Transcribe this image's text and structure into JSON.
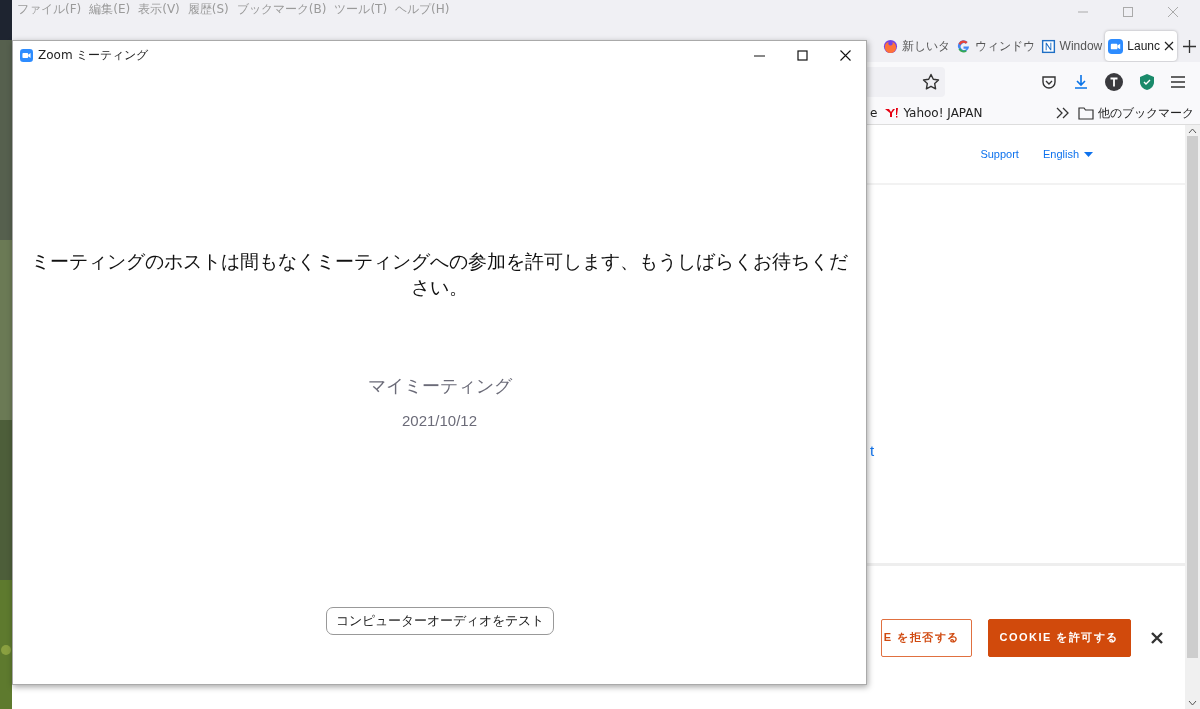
{
  "browser": {
    "menu_bar": [
      "ファイル(F)",
      "編集(E)",
      "表示(V)",
      "履歴(S)",
      "ブックマーク(B)",
      "ツール(T)",
      "ヘルプ(H)"
    ],
    "tabs": [
      {
        "label": "新しいタ",
        "kind": "fox",
        "selected": false
      },
      {
        "label": "ウィンドウ",
        "kind": "g",
        "selected": false
      },
      {
        "label": "Window",
        "kind": "n",
        "selected": false
      },
      {
        "label": "Launc",
        "kind": "camera",
        "selected": true
      }
    ],
    "bookmarks": [
      "e",
      "Yahoo! JAPAN"
    ],
    "other_bookmarks": "他のブックマーク",
    "page": {
      "nav": [
        "Support",
        "English"
      ],
      "link_fragment": "t",
      "cookie_buttons": [
        {
          "label": "E を拒否する",
          "kind": "outline"
        },
        {
          "label": "COOKIE を許可する",
          "kind": "filled"
        }
      ]
    }
  },
  "zoom_window": {
    "title": "Zoom ミーティング",
    "message": "ミーティングのホストは間もなくミーティングへの参加を許可します、もうしばらくお待ちください。",
    "meeting_name": "マイミーティング",
    "date": "2021/10/12",
    "button": "コンピューターオーディオをテスト"
  }
}
